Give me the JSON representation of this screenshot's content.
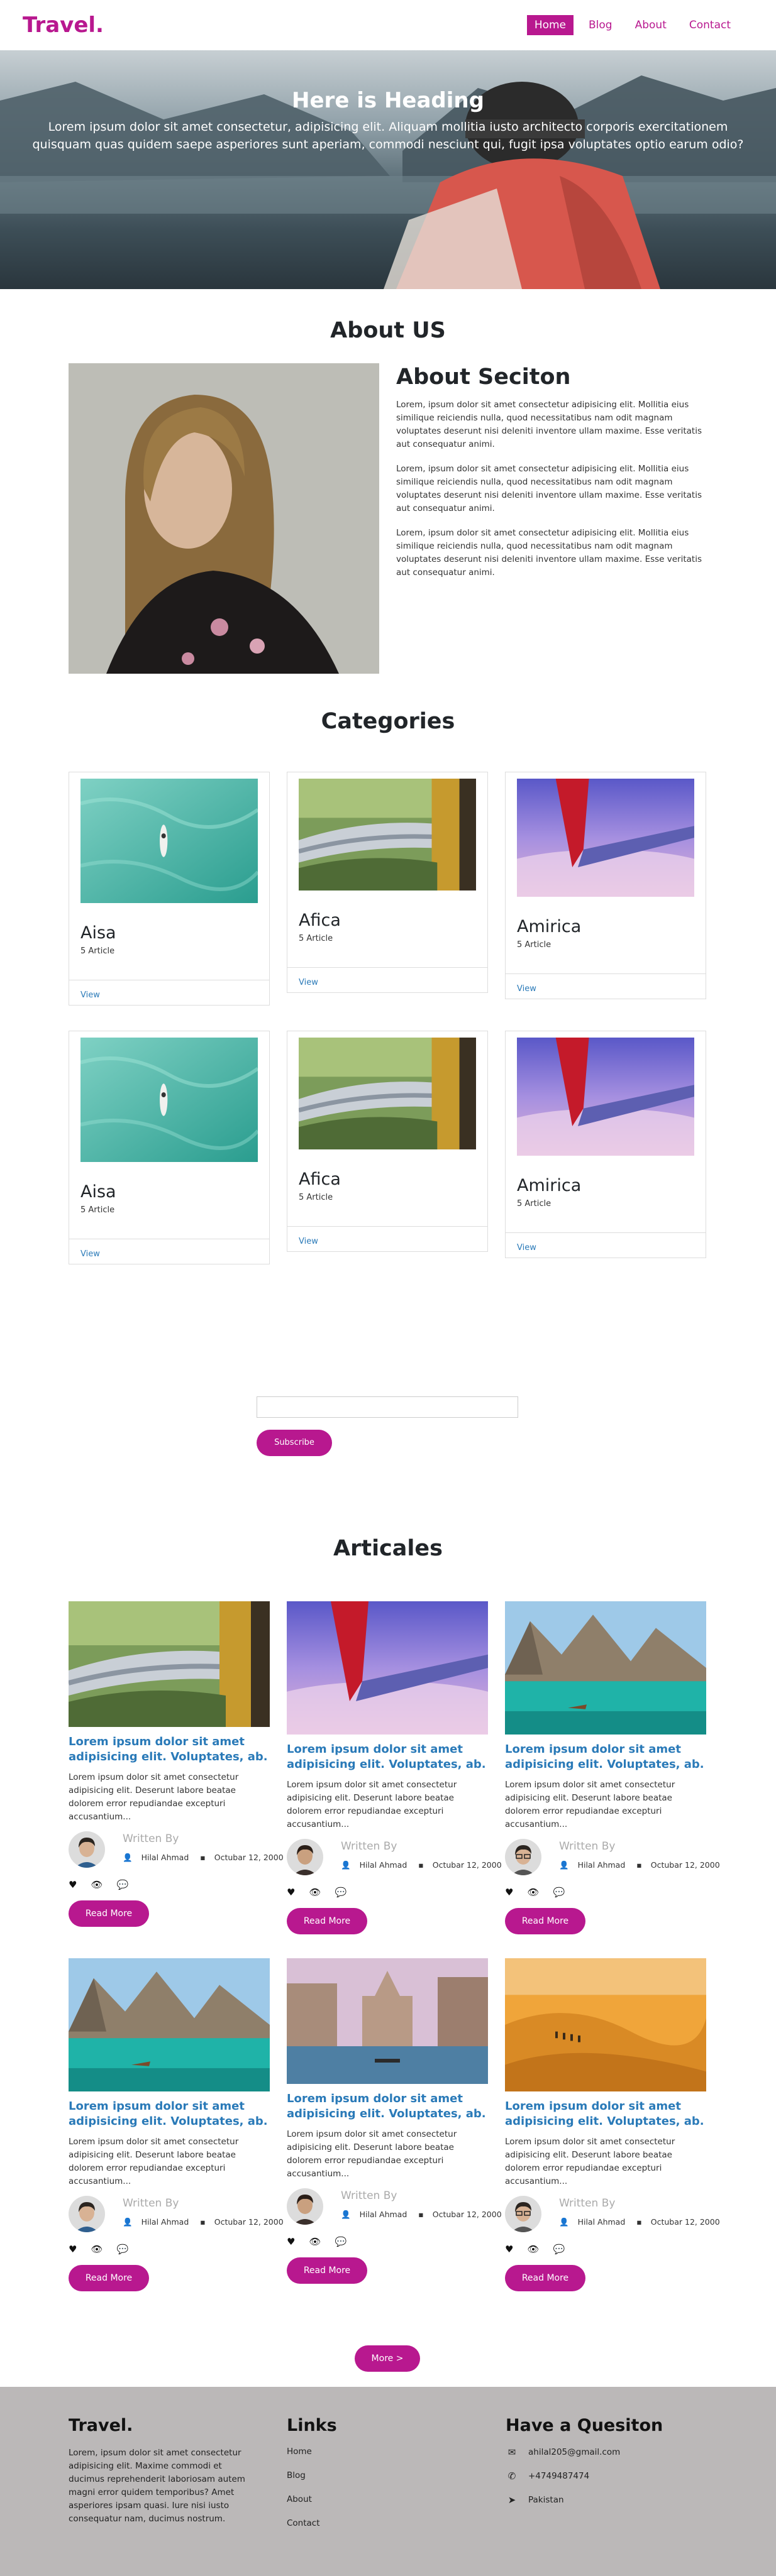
{
  "nav": {
    "logo": "Travel.",
    "links": [
      {
        "label": "Home",
        "active": true
      },
      {
        "label": "Blog",
        "active": false
      },
      {
        "label": "About",
        "active": false
      },
      {
        "label": "Contact",
        "active": false
      }
    ]
  },
  "hero": {
    "title": "Here is Heading",
    "text": "Lorem ipsum dolor sit amet consectetur, adipisicing elit. Aliquam mollitia iusto architecto corporis exercitationem quisquam quas quidem saepe asperiores sunt aperiam, commodi nesciunt qui, fugit ipsa voluptates optio earum odio?"
  },
  "about": {
    "section_title": "About US",
    "subtitle": "About Seciton",
    "paragraphs": [
      "Lorem, ipsum dolor sit amet consectetur adipisicing elit. Mollitia eius similique reiciendis nulla, quod necessitatibus nam odit magnam voluptates deserunt nisi deleniti inventore ullam maxime. Esse veritatis aut consequatur animi.",
      "Lorem, ipsum dolor sit amet consectetur adipisicing elit. Mollitia eius similique reiciendis nulla, quod necessitatibus nam odit magnam voluptates deserunt nisi deleniti inventore ullam maxime. Esse veritatis aut consequatur animi.",
      "Lorem, ipsum dolor sit amet consectetur adipisicing elit. Mollitia eius similique reiciendis nulla, quod necessitatibus nam odit magnam voluptates deserunt nisi deleniti inventore ullam maxime. Esse veritatis aut consequatur animi."
    ]
  },
  "categories": {
    "section_title": "Categories",
    "items": [
      {
        "name": "Aisa",
        "count": "5 Article",
        "link": "View",
        "image": "sea-boat"
      },
      {
        "name": "Afica",
        "count": "5 Article",
        "link": "View",
        "image": "train-bridge"
      },
      {
        "name": "Amirica",
        "count": "5 Article",
        "link": "View",
        "image": "plane-wing"
      },
      {
        "name": "Aisa",
        "count": "5 Article",
        "link": "View",
        "image": "sea-boat"
      },
      {
        "name": "Afica",
        "count": "5 Article",
        "link": "View",
        "image": "train-bridge"
      },
      {
        "name": "Amirica",
        "count": "5 Article",
        "link": "View",
        "image": "plane-wing"
      }
    ]
  },
  "subscribe": {
    "input_value": "",
    "button": "Subscribe"
  },
  "articles": {
    "section_title": "Articales",
    "written_by": "Written By",
    "read_more": "Read More",
    "items": [
      {
        "image": "train-bridge",
        "title": "Lorem ipsum dolor sit amet adipisicing elit. Voluptates, ab.",
        "desc": "Lorem ipsum dolor sit amet consectetur adipisicing elit. Deserunt labore beatae dolorem error repudiandae excepturi accusantium...",
        "author": "Hilal Ahmad",
        "date": "Octubar 12, 2000",
        "avatar": "man-blue"
      },
      {
        "image": "plane-wing",
        "title": "Lorem ipsum dolor sit amet adipisicing elit. Voluptates, ab.",
        "desc": "Lorem ipsum dolor sit amet consectetur adipisicing elit. Deserunt labore beatae dolorem error repudiandae excepturi accusantium...",
        "author": "Hilal Ahmad",
        "date": "Octubar 12, 2000",
        "avatar": "woman-dark"
      },
      {
        "image": "lake-mountain",
        "title": "Lorem ipsum dolor sit amet adipisicing elit. Voluptates, ab.",
        "desc": "Lorem ipsum dolor sit amet consectetur adipisicing elit. Deserunt labore beatae dolorem error repudiandae excepturi accusantium...",
        "author": "Hilal Ahmad",
        "date": "Octubar 12, 2000",
        "avatar": "man-glasses"
      },
      {
        "image": "lake-mountain",
        "title": "Lorem ipsum dolor sit amet adipisicing elit. Voluptates, ab.",
        "desc": "Lorem ipsum dolor sit amet consectetur adipisicing elit. Deserunt labore beatae dolorem error repudiandae excepturi accusantium...",
        "author": "Hilal Ahmad",
        "date": "Octubar 12, 2000",
        "avatar": "man-blue"
      },
      {
        "image": "venice",
        "title": "Lorem ipsum dolor sit amet adipisicing elit. Voluptates, ab.",
        "desc": "Lorem ipsum dolor sit amet consectetur adipisicing elit. Deserunt labore beatae dolorem error repudiandae excepturi accusantium...",
        "author": "Hilal Ahmad",
        "date": "Octubar 12, 2000",
        "avatar": "woman-dark"
      },
      {
        "image": "desert",
        "title": "Lorem ipsum dolor sit amet adipisicing elit. Voluptates, ab.",
        "desc": "Lorem ipsum dolor sit amet consectetur adipisicing elit. Deserunt labore beatae dolorem error repudiandae excepturi accusantium...",
        "author": "Hilal Ahmad",
        "date": "Octubar 12, 2000",
        "avatar": "man-glasses"
      }
    ],
    "more_button": "More >"
  },
  "footer": {
    "brand": "Travel.",
    "about": "Lorem, ipsum dolor sit amet consectetur adipisicing elit. Maxime commodi et ducimus reprehenderit laboriosam autem magni error quidem temporibus? Amet asperiores ipsam quasi. Iure nisi iusto consequatur nam, ducimus nostrum.",
    "links_title": "Links",
    "links": [
      "Home",
      "Blog",
      "About",
      "Contact"
    ],
    "contact_title": "Have a Quesiton",
    "contacts": [
      {
        "icon": "envelope-icon",
        "text": "ahilal205@gmail.com"
      },
      {
        "icon": "phone-icon",
        "text": "+4749487474"
      },
      {
        "icon": "location-arrow-icon",
        "text": "Pakistan"
      }
    ]
  },
  "colors": {
    "accent": "#b8188f",
    "link": "#2a7ab8",
    "footer_bg": "#bbb8b8"
  }
}
